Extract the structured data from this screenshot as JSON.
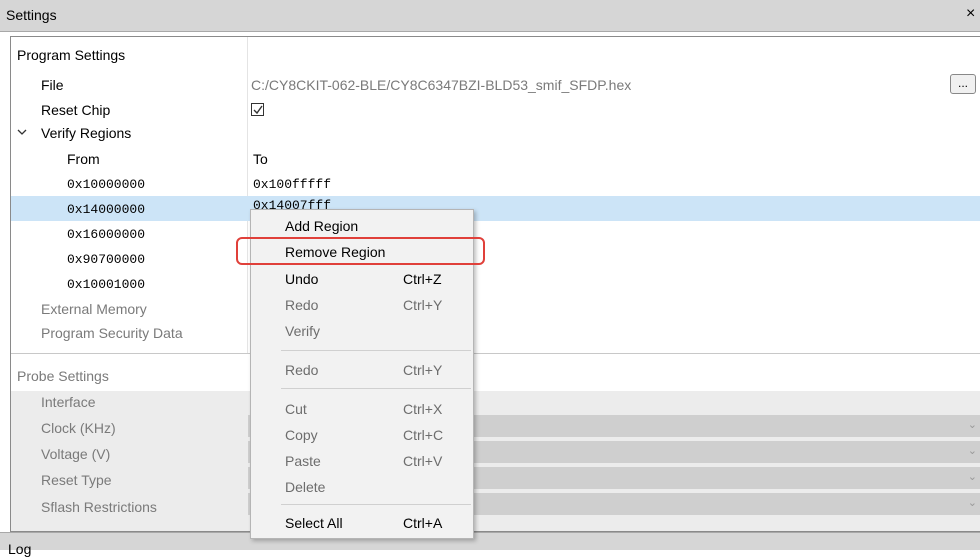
{
  "window": {
    "title": "Settings",
    "close_glyph": "×"
  },
  "program": {
    "header": "Program Settings",
    "file_label": "File",
    "file_value": "C:/CY8CKIT-062-BLE/CY8C6347BZI-BLD53_smif_SFDP.hex",
    "browse_label": "...",
    "reset_chip_label": "Reset Chip",
    "reset_chip_checked": true,
    "verify_regions_label": "Verify Regions",
    "from_header": "From",
    "to_header": "To",
    "regions": [
      {
        "from": "0x10000000",
        "to": "0x100fffff"
      },
      {
        "from": "0x14000000",
        "to": "0x14007fff"
      },
      {
        "from": "0x16000000",
        "to": ""
      },
      {
        "from": "0x90700000",
        "to": ""
      },
      {
        "from": "0x10001000",
        "to": ""
      }
    ],
    "external_memory_label": "External Memory",
    "security_label": "Program Security Data"
  },
  "probe": {
    "header": "Probe Settings",
    "fields": [
      "Interface",
      "Clock (KHz)",
      "Voltage (V)",
      "Reset Type",
      "Sflash Restrictions"
    ]
  },
  "log_label": "Log",
  "context_menu": {
    "items": [
      {
        "label": "Add Region",
        "shortcut": ""
      },
      {
        "label": "Remove Region",
        "shortcut": ""
      },
      {
        "label": "Undo",
        "shortcut": "Ctrl+Z"
      },
      {
        "label": "Redo",
        "shortcut": "Ctrl+Y"
      },
      {
        "label": "Verify",
        "shortcut": ""
      },
      {
        "label": "Redo",
        "shortcut": "Ctrl+Y"
      },
      {
        "label": "Cut",
        "shortcut": "Ctrl+X"
      },
      {
        "label": "Copy",
        "shortcut": "Ctrl+C"
      },
      {
        "label": "Paste",
        "shortcut": "Ctrl+V"
      },
      {
        "label": "Delete",
        "shortcut": ""
      },
      {
        "label": "Select All",
        "shortcut": "Ctrl+A"
      }
    ]
  },
  "colors": {
    "selection": "#cce4f7",
    "highlight_border": "#e0403a"
  }
}
